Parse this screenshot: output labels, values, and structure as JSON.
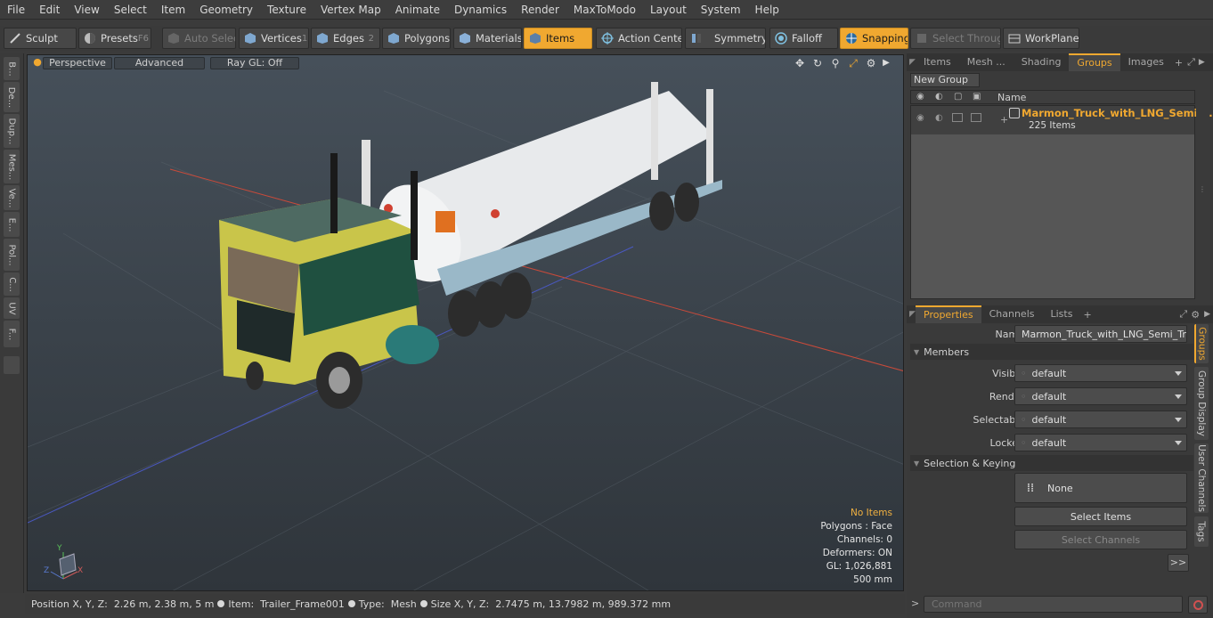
{
  "menu": [
    "File",
    "Edit",
    "View",
    "Select",
    "Item",
    "Geometry",
    "Texture",
    "Vertex Map",
    "Animate",
    "Dynamics",
    "Render",
    "MaxToModo",
    "Layout",
    "System",
    "Help"
  ],
  "toolbar": {
    "sculpt": "Sculpt",
    "presets": "Presets",
    "presets_key": "F6",
    "auto_select": "Auto Select",
    "vertices": "Vertices",
    "vertices_key": "1",
    "edges": "Edges",
    "edges_key": "2",
    "polygons": "Polygons",
    "materials": "Materials",
    "items": "Items",
    "action_center": "Action Center",
    "symmetry": "Symmetry",
    "falloff": "Falloff",
    "snapping": "Snapping",
    "select_through": "Select Through",
    "workplane": "WorkPlane"
  },
  "left_tabs": [
    "B...",
    "De...",
    "Dup...",
    "Mes...",
    "Ve...",
    "E...",
    "Pol...",
    "C...",
    "UV",
    "F..."
  ],
  "viewport": {
    "view_mode": "Perspective",
    "shading": "Advanced",
    "raygl": "Ray GL: Off",
    "info": {
      "selection": "No Items",
      "polygons": "Polygons : Face",
      "channels": "Channels: 0",
      "deformers": "Deformers: ON",
      "gl": "GL: 1,026,881",
      "scale": "500 mm"
    },
    "axis_y": "Y",
    "axis_x": "X",
    "axis_z": "Z"
  },
  "status": {
    "position_label": "Position X, Y, Z:",
    "position_value": "2.26 m, 2.38 m, 5 m",
    "item_label": "Item:",
    "item_value": "Trailer_Frame001",
    "type_label": "Type:",
    "type_value": "Mesh",
    "size_label": "Size X, Y, Z:",
    "size_value": "2.7475 m, 13.7982 m, 989.372 mm"
  },
  "top_tabs": [
    "Items",
    "Mesh ...",
    "Shading",
    "Groups",
    "Images"
  ],
  "top_active": "Groups",
  "groups": {
    "new_group": "New Group",
    "name_col": "Name",
    "group_name": "Marmon_Truck_with_LNG_Semi ...",
    "group_count": "225 Items"
  },
  "prop_tabs": [
    "Properties",
    "Channels",
    "Lists"
  ],
  "properties": {
    "name_label": "Name",
    "name_value": "Marmon_Truck_with_LNG_Semi_Trailer",
    "members": "Members",
    "visible_label": "Visible",
    "visible_value": "default",
    "render_label": "Render",
    "render_value": "default",
    "selectable_label": "Selectable",
    "selectable_value": "default",
    "locked_label": "Locked",
    "locked_value": "default",
    "selection_keying": "Selection & Keying",
    "none_btn": "None",
    "select_items": "Select Items",
    "select_channels": "Select Channels",
    "more": ">>"
  },
  "right_vtabs": [
    "Groups",
    "Group Display",
    "User Channels",
    "Tags"
  ],
  "command": {
    "placeholder": "Command"
  },
  "colors": {
    "accent": "#f0a830"
  }
}
